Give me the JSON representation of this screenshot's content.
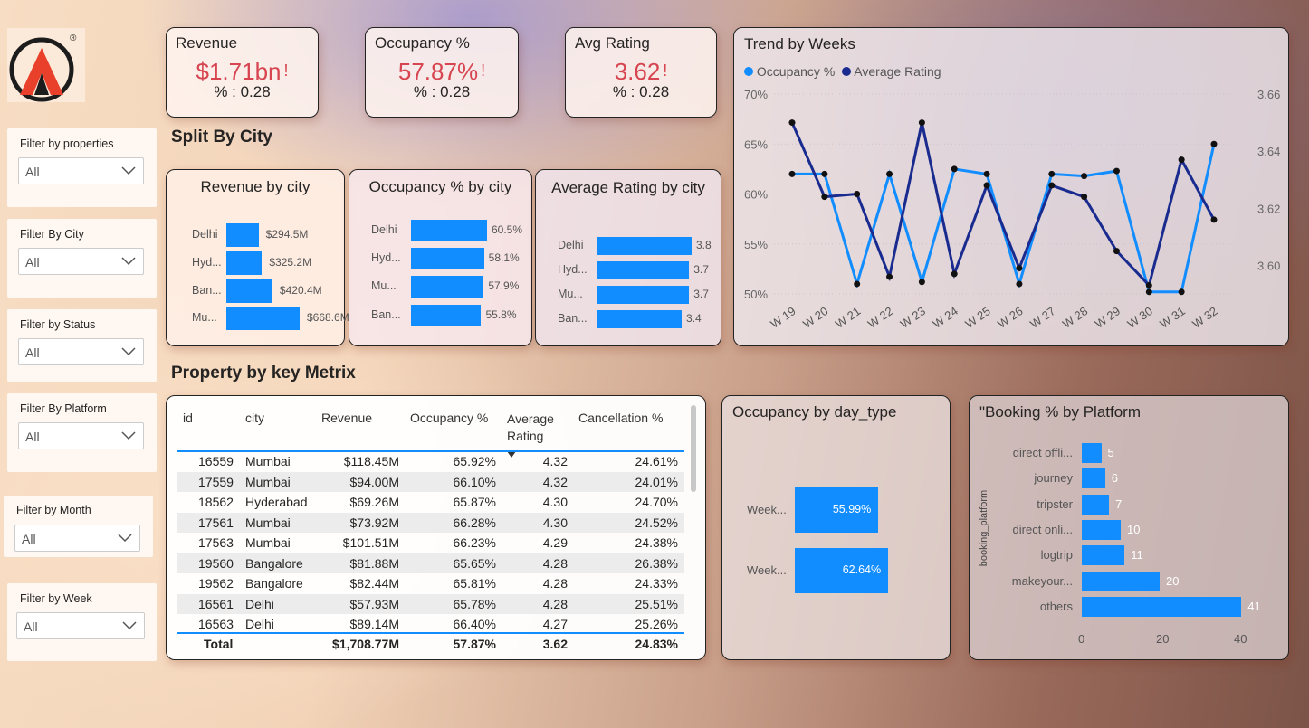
{
  "logo": {
    "registered": "®"
  },
  "kpis": [
    {
      "title": "Revenue",
      "value": "$1.71bn",
      "sub": "% : 0.28",
      "flag": "!"
    },
    {
      "title": "Occupancy %",
      "value": "57.87%",
      "sub": "% : 0.28",
      "flag": "!"
    },
    {
      "title": "Avg Rating",
      "value": "3.62",
      "sub": "% : 0.28",
      "flag": "!"
    }
  ],
  "colors": {
    "accent": "#118dff",
    "dark_series": "#1a2b8f",
    "alert": "#d64550"
  },
  "filters": [
    {
      "label": "Filter by properties",
      "value": "All"
    },
    {
      "label": "Filter By City",
      "value": "All"
    },
    {
      "label": "Filter by Status",
      "value": "All"
    },
    {
      "label": "Filter By Platform",
      "value": "All"
    },
    {
      "label": "Filter by Month",
      "value": "All"
    },
    {
      "label": "Filter by Week",
      "value": "All"
    }
  ],
  "sections": {
    "split": "Split By City",
    "property": "Property by key Metrix"
  },
  "chart_data": [
    {
      "id": "revenue_city",
      "type": "bar",
      "title": "Revenue by city",
      "categories": [
        "Delhi",
        "Hyd...",
        "Ban...",
        "Mu..."
      ],
      "values": [
        294.5,
        325.2,
        420.4,
        668.6
      ],
      "labels": [
        "$294.5M",
        "$325.2M",
        "$420.4M",
        "$668.6M"
      ]
    },
    {
      "id": "occupancy_city",
      "type": "bar",
      "title": "Occupancy % by city",
      "categories": [
        "Delhi",
        "Hyd...",
        "Mu...",
        "Ban..."
      ],
      "values": [
        60.5,
        58.1,
        57.9,
        55.8
      ],
      "labels": [
        "60.5%",
        "58.1%",
        "57.9%",
        "55.8%"
      ]
    },
    {
      "id": "rating_city",
      "type": "bar",
      "title": "Average Rating by city",
      "categories": [
        "Delhi",
        "Hyd...",
        "Mu...",
        "Ban..."
      ],
      "values": [
        3.8,
        3.7,
        3.7,
        3.4
      ],
      "labels": [
        "3.8",
        "3.7",
        "3.7",
        "3.4"
      ]
    },
    {
      "id": "trend",
      "type": "line",
      "title": "Trend by Weeks",
      "categories": [
        "W 19",
        "W 20",
        "W 21",
        "W 22",
        "W 23",
        "W 24",
        "W 25",
        "W 26",
        "W 27",
        "W 28",
        "W 29",
        "W 30",
        "W 31",
        "W 32"
      ],
      "series": [
        {
          "name": "Occupancy %",
          "axis": "left",
          "values": [
            62.0,
            62.0,
            51.0,
            62.0,
            51.2,
            62.5,
            62.0,
            51.0,
            62.0,
            61.8,
            62.3,
            50.2,
            50.2,
            65.0
          ]
        },
        {
          "name": "Average Rating",
          "axis": "right",
          "values": [
            3.65,
            3.624,
            3.625,
            3.596,
            3.65,
            3.597,
            3.628,
            3.599,
            3.628,
            3.624,
            3.605,
            3.593,
            3.637,
            3.616
          ]
        }
      ],
      "ylim_left": [
        50,
        70
      ],
      "yticks_left": [
        "70%",
        "65%",
        "60%",
        "55%",
        "50%"
      ],
      "ylim_right": [
        3.59,
        3.66
      ],
      "yticks_right": [
        "3.66",
        "3.64",
        "3.62",
        "3.60"
      ],
      "legend": "top-left",
      "grid": true
    },
    {
      "id": "day_type",
      "type": "bar",
      "title": "Occupancy by day_type",
      "categories": [
        "Week...",
        "Week..."
      ],
      "values": [
        55.99,
        62.64
      ],
      "labels": [
        "55.99%",
        "62.64%"
      ]
    },
    {
      "id": "platform",
      "type": "bar",
      "title": "\"Booking % by Platform",
      "categories": [
        "direct offli...",
        "journey",
        "tripster",
        "direct onli...",
        "logtrip",
        "makeyour...",
        "others"
      ],
      "values": [
        5,
        6,
        7,
        10,
        11,
        20,
        41
      ],
      "ylabel": "booking_platform",
      "xticks": [
        "0",
        "20",
        "40"
      ],
      "xlim": [
        0,
        47
      ]
    }
  ],
  "table": {
    "headers": [
      "id",
      "city",
      "Revenue",
      "Occupancy %",
      "Average Rating",
      "Cancellation %"
    ],
    "rows": [
      [
        "16559",
        "Mumbai",
        "$118.45M",
        "65.92%",
        "4.32",
        "24.61%"
      ],
      [
        "17559",
        "Mumbai",
        "$94.00M",
        "66.10%",
        "4.32",
        "24.01%"
      ],
      [
        "18562",
        "Hyderabad",
        "$69.26M",
        "65.87%",
        "4.30",
        "24.70%"
      ],
      [
        "17561",
        "Mumbai",
        "$73.92M",
        "66.28%",
        "4.30",
        "24.52%"
      ],
      [
        "17563",
        "Mumbai",
        "$101.51M",
        "66.23%",
        "4.29",
        "24.38%"
      ],
      [
        "19560",
        "Bangalore",
        "$81.88M",
        "65.65%",
        "4.28",
        "26.38%"
      ],
      [
        "19562",
        "Bangalore",
        "$82.44M",
        "65.81%",
        "4.28",
        "24.33%"
      ],
      [
        "16561",
        "Delhi",
        "$57.93M",
        "65.78%",
        "4.28",
        "25.51%"
      ],
      [
        "16563",
        "Delhi",
        "$89.14M",
        "66.40%",
        "4.27",
        "25.26%"
      ]
    ],
    "total": [
      "Total",
      "$1,708.77M",
      "57.87%",
      "3.62",
      "24.83%"
    ]
  }
}
